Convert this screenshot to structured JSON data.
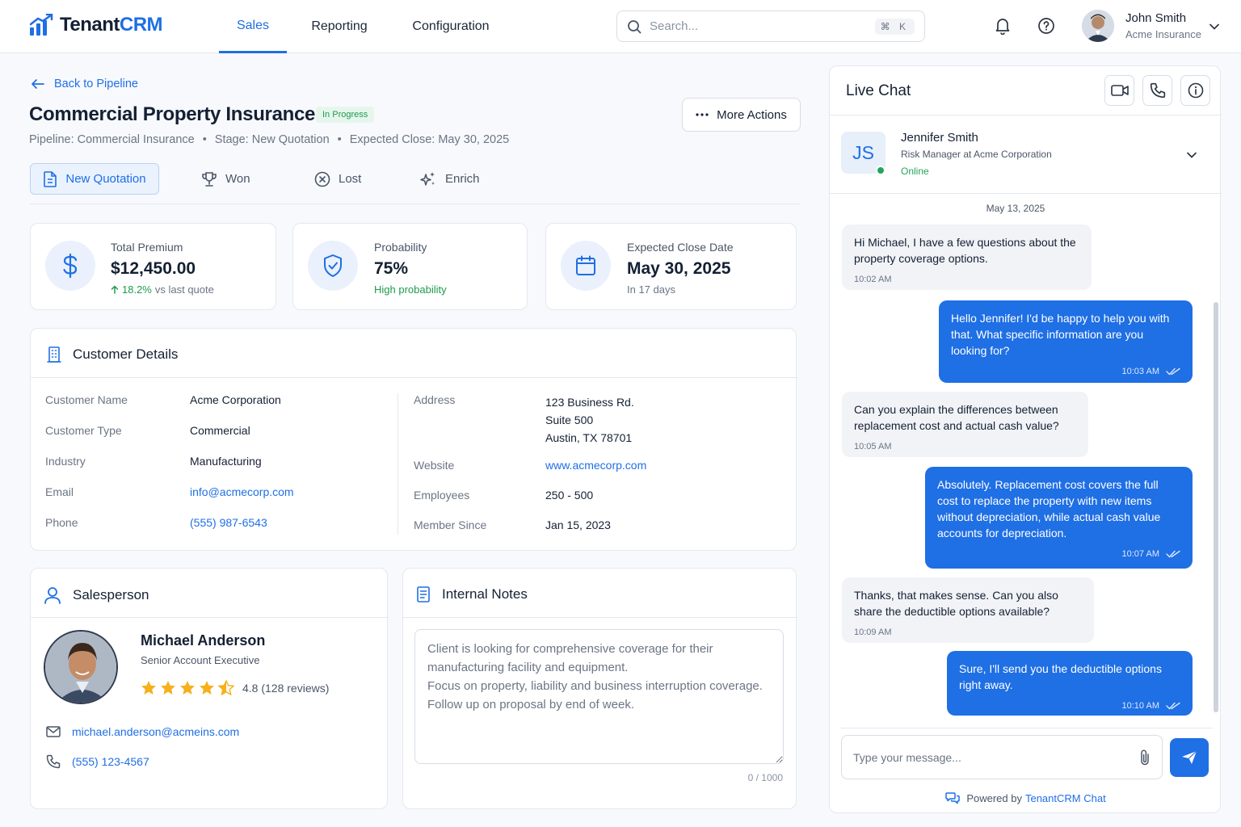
{
  "app": {
    "logo_a": "Tenant",
    "logo_b": "CRM"
  },
  "nav": {
    "tabs": [
      "Sales",
      "Reporting",
      "Configuration"
    ]
  },
  "search": {
    "placeholder": "Search...",
    "shortcut": "⌘ K"
  },
  "user": {
    "name": "John Smith",
    "org": "Acme Insurance"
  },
  "deal": {
    "back": "Back to Pipeline",
    "title": "Commercial Property Insurance",
    "status": "In Progress",
    "pipeline": "Pipeline: Commercial Insurance",
    "stage": "Stage: New Quotation",
    "expected": "Expected Close: May 30, 2025",
    "sep": "•",
    "more_actions": "More Actions",
    "stages": [
      "New Quotation",
      "Won",
      "Lost",
      "Enrich"
    ]
  },
  "stats": [
    {
      "label": "Total Premium",
      "value": "$12,450.00",
      "change": "18.2%",
      "sub": "vs last quote"
    },
    {
      "label": "Probability",
      "value": "75%",
      "sub": "High probability"
    },
    {
      "label": "Expected Close Date",
      "value": "May 30, 2025",
      "sub": "In 17 days"
    }
  ],
  "customer": {
    "title": "Customer Details",
    "left": [
      {
        "k": "Customer Name",
        "v": "Acme Corporation"
      },
      {
        "k": "Customer Type",
        "v": "Commercial"
      },
      {
        "k": "Industry",
        "v": "Manufacturing"
      },
      {
        "k": "Email",
        "v": "info@acmecorp.com"
      },
      {
        "k": "Phone",
        "v": "(555) 987-6543"
      }
    ],
    "address_label": "Address",
    "address": [
      "123 Business Rd.",
      "Suite 500",
      "Austin, TX 78701"
    ],
    "right": [
      {
        "k": "Website",
        "v": "www.acmecorp.com"
      },
      {
        "k": "Employees",
        "v": "250 - 500"
      },
      {
        "k": "Member Since",
        "v": "Jan 15, 2023"
      }
    ]
  },
  "salesperson": {
    "title": "Salesperson",
    "name": "Michael Anderson",
    "role": "Senior Account Executive",
    "rating_text": "4.8 (128 reviews)",
    "rating": 4.5,
    "email": "michael.anderson@acmeins.com",
    "phone": "(555) 123-4567"
  },
  "notes": {
    "title": "Internal Notes",
    "text": "Client is looking for comprehensive coverage for their manufacturing facility and equipment.\nFocus on property, liability and business interruption coverage.\nFollow up on proposal by end of week.",
    "counter": "0 / 1000"
  },
  "chat": {
    "title": "Live Chat",
    "contact": {
      "initials": "JS",
      "name": "Jennifer Smith",
      "role": "Risk Manager at Acme Corporation",
      "status": "Online"
    },
    "date": "May 13, 2025",
    "messages": [
      {
        "dir": "in",
        "text": "Hi Michael, I have a few questions about the property coverage options.",
        "time": "10:02 AM"
      },
      {
        "dir": "out",
        "text": "Hello Jennifer! I'd be happy to help you with that. What specific information are you looking for?",
        "time": "10:03 AM"
      },
      {
        "dir": "in",
        "text": "Can you explain the differences between replacement cost and actual cash value?",
        "time": "10:05 AM"
      },
      {
        "dir": "out",
        "text": "Absolutely. Replacement cost covers the full cost to replace the property with new items without depreciation, while actual cash value accounts for depreciation.",
        "time": "10:07 AM"
      },
      {
        "dir": "in",
        "text": "Thanks, that makes sense. Can you also share the deductible options available?",
        "time": "10:09 AM"
      },
      {
        "dir": "out",
        "text": "Sure, I'll send you the deductible options right away.",
        "time": "10:10 AM"
      }
    ],
    "input_placeholder": "Type your message...",
    "powered_prefix": "Powered by",
    "powered_brand": "TenantCRM Chat"
  },
  "colors": {
    "accent": "#1f6fe5",
    "success": "#1e9b4f",
    "star": "#f5b01a"
  }
}
